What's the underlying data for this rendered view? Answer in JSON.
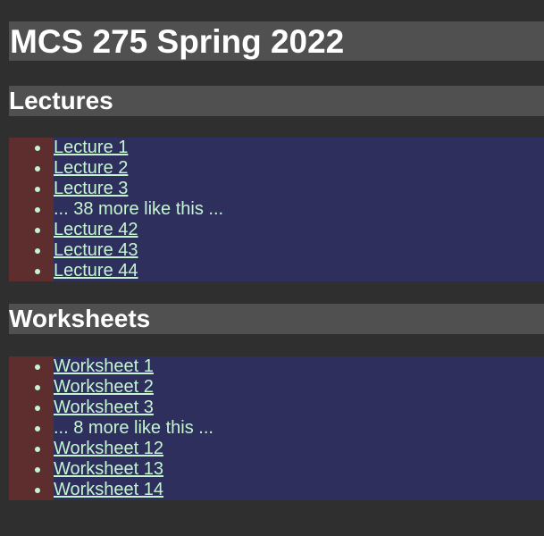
{
  "title": "MCS 275 Spring 2022",
  "sections": {
    "lectures": {
      "heading": "Lectures",
      "items": [
        {
          "label": "Lecture 1",
          "link": true
        },
        {
          "label": "Lecture 2",
          "link": true
        },
        {
          "label": "Lecture 3",
          "link": true
        },
        {
          "label": "... 38 more like this ...",
          "link": false
        },
        {
          "label": "Lecture 42",
          "link": true
        },
        {
          "label": "Lecture 43",
          "link": true
        },
        {
          "label": "Lecture 44",
          "link": true
        }
      ]
    },
    "worksheets": {
      "heading": "Worksheets",
      "items": [
        {
          "label": "Worksheet 1",
          "link": true
        },
        {
          "label": "Worksheet 2",
          "link": true
        },
        {
          "label": "Worksheet 3",
          "link": true
        },
        {
          "label": "... 8 more like this ...",
          "link": false
        },
        {
          "label": "Worksheet 12",
          "link": true
        },
        {
          "label": "Worksheet 13",
          "link": true
        },
        {
          "label": "Worksheet 14",
          "link": true
        }
      ]
    }
  },
  "colors": {
    "page_bg": "#2f2f2f",
    "heading_bg": "#505050",
    "list_padding_bg": "#5e2e2e",
    "list_bg": "#2f2f5e",
    "link_color": "#c4f5d0"
  }
}
